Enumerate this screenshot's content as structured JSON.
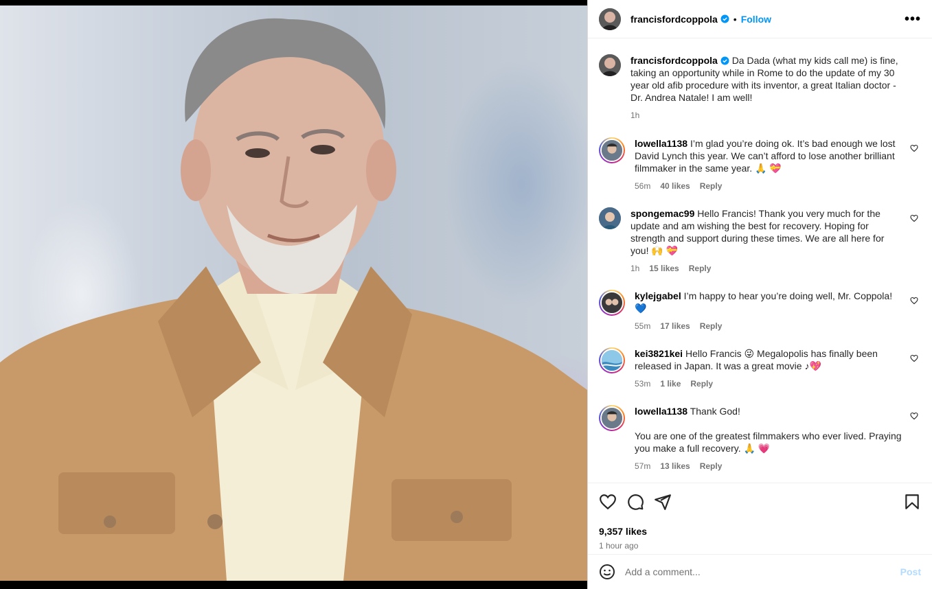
{
  "post": {
    "author": "francisfordcoppola",
    "follow_label": "Follow",
    "dot": "•",
    "more_label": "•••",
    "caption": "Da Dada (what my kids call me) is fine, taking an opportunity while in Rome to do the update of my 30 year old afib procedure with its inventor, a great Italian doctor - Dr. Andrea Natale! I am well!",
    "caption_time": "1h",
    "likes": "9,357 likes",
    "time_ago": "1 hour ago"
  },
  "comments": [
    {
      "user": "lowella1138",
      "text": "I’m glad you’re doing ok. It’s bad enough we lost David Lynch this year. We can’t afford to lose another brilliant filmmaker in the same year. 🙏 💝",
      "time": "56m",
      "likes": "40 likes",
      "reply": "Reply"
    },
    {
      "user": "spongemac99",
      "text": "Hello Francis! Thank you very much for the update and am wishing the best for recovery. Hoping for strength and support during these times. We are all here for you! 🙌 💝",
      "time": "1h",
      "likes": "15 likes",
      "reply": "Reply"
    },
    {
      "user": "kylejgabel",
      "text": "I’m happy to hear you’re doing well, Mr. Coppola! 💙",
      "time": "55m",
      "likes": "17 likes",
      "reply": "Reply"
    },
    {
      "user": "kei3821kei",
      "text": "Hello Francis 😜 Megalopolis has finally been released in Japan. It was a great movie ♪💖",
      "time": "53m",
      "likes": "1 like",
      "reply": "Reply"
    },
    {
      "user": "lowella1138",
      "text": "Thank God!",
      "text2": "You are one of the greatest filmmakers who ever lived. Praying you make a full recovery. 🙏 💗",
      "time": "57m",
      "likes": "13 likes",
      "reply": "Reply"
    }
  ],
  "composer": {
    "placeholder": "Add a comment...",
    "post_label": "Post"
  },
  "icons": {
    "like": "heart-icon",
    "comment": "comment-icon",
    "share": "share-icon",
    "save": "bookmark-icon",
    "emoji": "emoji-icon",
    "verified": "verified-badge-icon",
    "more": "more-options-icon"
  },
  "colors": {
    "accent": "#0095f6",
    "post_disabled": "#b3dbff",
    "jacket": "#c89a6a"
  }
}
